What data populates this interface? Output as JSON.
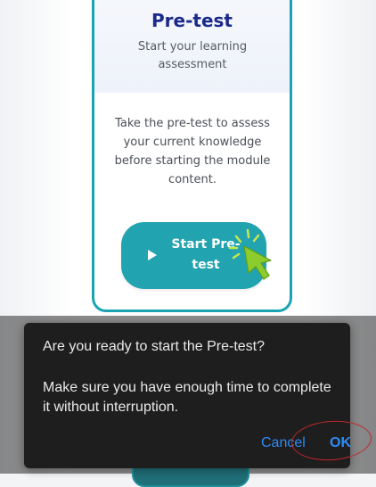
{
  "card": {
    "title": "Pre-test",
    "subtitle": "Start your learning assessment",
    "description": "Take the pre-test to assess your current knowledge before starting the module content.",
    "start_button": {
      "label_line1": "Start Pre-",
      "label_line2": "test",
      "icon": "play-icon"
    }
  },
  "dialog": {
    "title": "Are you ready to start the Pre-test?",
    "message": "Make sure you have enough time to complete it without interruption.",
    "cancel_label": "Cancel",
    "ok_label": "OK"
  },
  "colors": {
    "accent_teal": "#21a3b0",
    "title_navy": "#1b2a8a",
    "dialog_bg": "#1e1e1e",
    "dialog_action_blue": "#2e8bf7",
    "annotation_red": "#c0282b"
  },
  "icons": {
    "cursor": "hand-pointer-click-icon",
    "annotation": "red-circle-annotation"
  }
}
